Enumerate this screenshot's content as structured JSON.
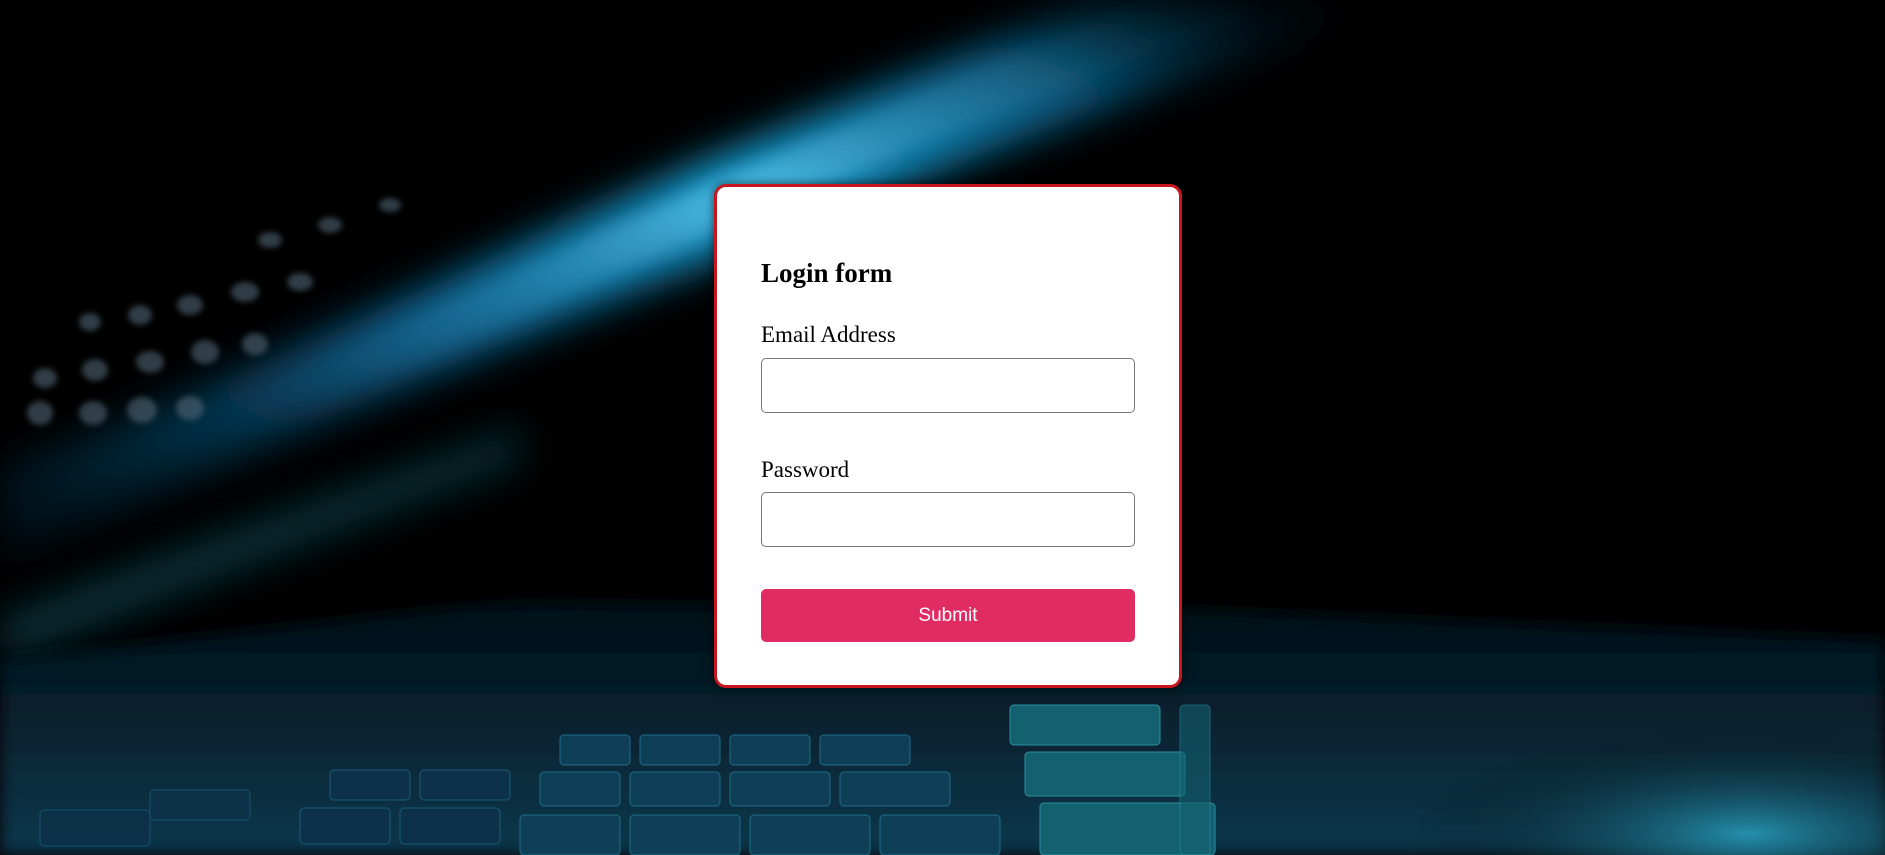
{
  "login_form": {
    "title": "Login form",
    "email_label": "Email Address",
    "email_value": "",
    "password_label": "Password",
    "password_value": "",
    "submit_label": "Submit"
  },
  "colors": {
    "card_border": "#c7161f",
    "submit_background": "#e02c63",
    "submit_text": "#ffffff",
    "page_background": "#000000"
  }
}
